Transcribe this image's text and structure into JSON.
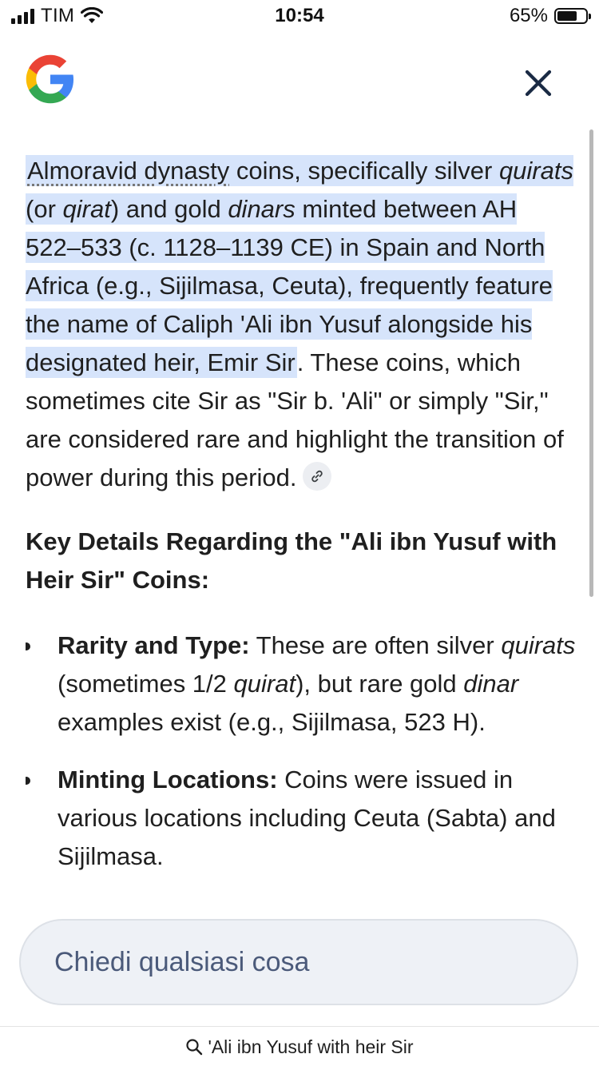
{
  "status_bar": {
    "carrier": "TIM",
    "time": "10:54",
    "battery": "65%"
  },
  "content": {
    "intro": {
      "term": "Almoravid dynasty",
      "p1": " coins, specifically silver ",
      "i1": "quirats",
      "p2": " (or ",
      "i2": "qirat",
      "p3": ") and gold ",
      "i3": "dinars",
      "p4": " minted between AH 522–533 (c. 1128–1139 CE) in Spain and North Africa (e.g., Sijilmasa, Ceuta), frequently feature the name of Caliph 'Ali ibn Yusuf alongside his designated heir, Emir Sir",
      "rest": ". These coins, which sometimes cite Sir as \"Sir b. 'Ali\" or simply \"Sir,\" are considered rare and highlight the transition of power during this period."
    },
    "heading": "Key Details Regarding the \"Ali ibn Yusuf with Heir Sir\" Coins:",
    "bullets": [
      {
        "label": "Rarity and Type:",
        "t1": " These are often silver ",
        "i1": "quirats",
        "t2": " (sometimes 1/2 ",
        "i2": "quirat",
        "t3": "), but rare gold ",
        "i3": "dinar",
        "t4": " examples exist (e.g., Sijilmasa, 523 H)."
      },
      {
        "label": "Minting Locations:",
        "t1": " Coins were issued in various locations including Ceuta (Sabta) and Sijilmasa."
      }
    ]
  },
  "ask": {
    "placeholder": "Chiedi qualsiasi cosa"
  },
  "query": {
    "text": "'Ali ibn Yusuf with heir Sir"
  },
  "icons": {
    "logo": "google-g-icon",
    "close": "close-icon",
    "link": "link-icon",
    "search": "search-icon"
  },
  "colors": {
    "highlight": "#d6e4fb",
    "ask_bg": "#eef1f6",
    "ask_text": "#4b5a7a"
  }
}
